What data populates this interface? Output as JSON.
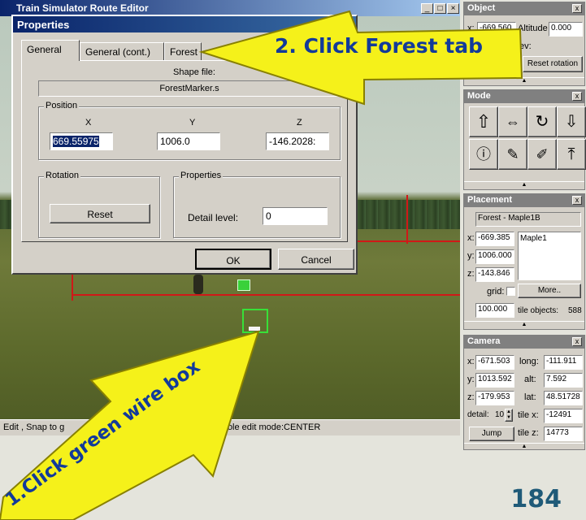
{
  "app": {
    "title": "Train Simulator Route Editor",
    "status_text": "Edit , Snap to g",
    "status_text_2": "Telephone pole edit mode:CENTER"
  },
  "dialog": {
    "title": "Properties",
    "tabs": [
      {
        "label": "General"
      },
      {
        "label": "General (cont.)"
      },
      {
        "label": "Forest"
      }
    ],
    "shape_file_label": "Shape file:",
    "shape_file_value": "ForestMarker.s",
    "position_label": "Position",
    "x_label": "X",
    "y_label": "Y",
    "z_label": "Z",
    "x_value": "669.55975",
    "y_value": "1006.0",
    "z_value": "-146.2028:",
    "rotation_label": "Rotation",
    "reset_label": "Reset",
    "properties_label": "Properties",
    "detail_level_label": "Detail level:",
    "detail_level_value": "0",
    "ok_label": "OK",
    "cancel_label": "Cancel"
  },
  "object_panel": {
    "title": "Object",
    "x_label": "x:",
    "x_value": "-669.560",
    "altitude_label": "Altitude",
    "altitude_value": "0.000",
    "rev_label": "ev:",
    "reset_rotation_label": "Reset rotation"
  },
  "mode_panel": {
    "title": "Mode",
    "buttons": [
      "place-icon",
      "move-icon",
      "rotate-icon",
      "drop-icon",
      "info-icon",
      "paint-icon",
      "pick-icon",
      "lift-icon"
    ]
  },
  "placement_panel": {
    "title": "Placement",
    "object_name": "Forest - Maple1B",
    "x_label": "x:",
    "x_value": "-669.385",
    "y_label": "y:",
    "y_value": "1006.000",
    "z_label": "z:",
    "z_value": "-143.846",
    "list_item": "Maple1",
    "grid_label": "grid:",
    "more_label": "More..",
    "grid_value": "100.000",
    "tile_objects_label": "tile objects:",
    "tile_objects_value": "588"
  },
  "camera_panel": {
    "title": "Camera",
    "x_label": "x:",
    "x_value": "-671.503",
    "long_label": "long:",
    "long_value": "-111.911",
    "y_label": "y:",
    "y_value": "1013.592",
    "alt_label": "alt:",
    "alt_value": "7.592",
    "z_label": "z:",
    "z_value": "-179.953",
    "lat_label": "lat:",
    "lat_value": "48.51728",
    "detail_label": "detail:",
    "detail_value": "10",
    "tile_x_label": "tile x:",
    "tile_x_value": "-12491",
    "jump_label": "Jump",
    "tile_z_label": "tile z:",
    "tile_z_value": "14773"
  },
  "annotations": {
    "step1": "1.Click green wire box",
    "step2": "2. Click Forest tab"
  },
  "page_number": "184",
  "colors": {
    "arrow_fill": "#f5f11a",
    "title_bar": "#0a246a",
    "page_number": "#1f5a78"
  }
}
